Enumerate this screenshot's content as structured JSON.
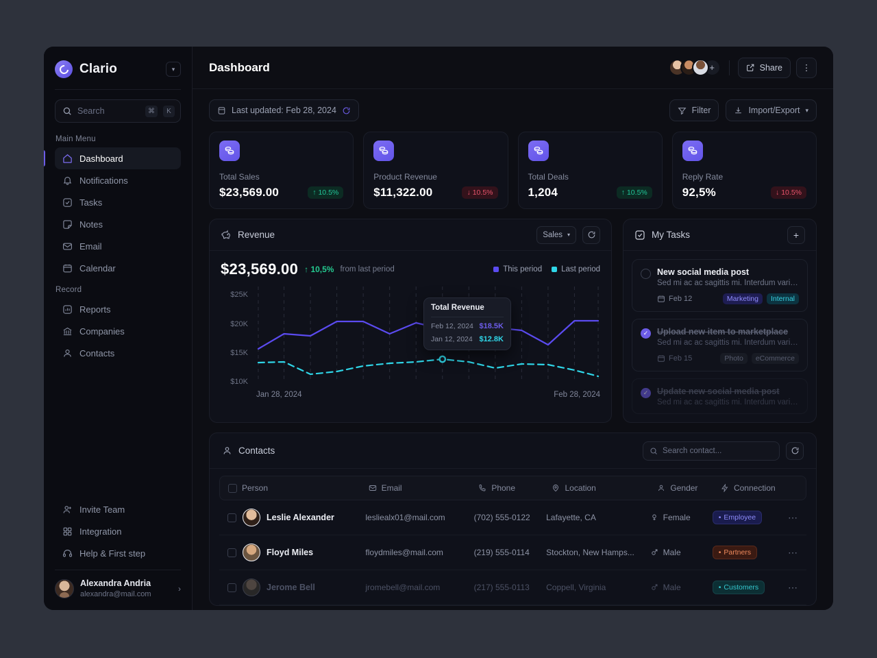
{
  "sidebar": {
    "brand": "Clario",
    "search": {
      "placeholder": "Search",
      "kbd1": "⌘",
      "kbd2": "K"
    },
    "groups": [
      {
        "label": "Main Menu",
        "items": [
          {
            "label": "Dashboard",
            "icon": "home-icon",
            "active": true
          },
          {
            "label": "Notifications",
            "icon": "bell-icon"
          },
          {
            "label": "Tasks",
            "icon": "check-square-icon"
          },
          {
            "label": "Notes",
            "icon": "note-icon"
          },
          {
            "label": "Email",
            "icon": "mail-icon"
          },
          {
            "label": "Calendar",
            "icon": "calendar-icon"
          }
        ]
      },
      {
        "label": "Record",
        "items": [
          {
            "label": "Reports",
            "icon": "chart-bar-icon"
          },
          {
            "label": "Companies",
            "icon": "bank-icon"
          },
          {
            "label": "Contacts",
            "icon": "user-icon"
          }
        ]
      }
    ],
    "bottom": [
      {
        "label": "Invite Team",
        "icon": "user-plus-icon"
      },
      {
        "label": "Integration",
        "icon": "grid-icon"
      },
      {
        "label": "Help & First step",
        "icon": "headset-icon"
      }
    ],
    "user": {
      "name": "Alexandra Andria",
      "email": "alexandra@mail.com"
    }
  },
  "topbar": {
    "title": "Dashboard",
    "add_label": "+",
    "share_label": "Share",
    "more_label": "⋮"
  },
  "toolbar": {
    "last_updated": "Last updated: Feb 28, 2024",
    "filter_label": "Filter",
    "import_export_label": "Import/Export"
  },
  "kpis": [
    {
      "label": "Total Sales",
      "value": "$23,569.00",
      "delta": "10.5%",
      "dir": "up"
    },
    {
      "label": "Product Revenue",
      "value": "$11,322.00",
      "delta": "10.5%",
      "dir": "down"
    },
    {
      "label": "Total Deals",
      "value": "1,204",
      "delta": "10.5%",
      "dir": "up"
    },
    {
      "label": "Reply Rate",
      "value": "92,5%",
      "delta": "10.5%",
      "dir": "down"
    }
  ],
  "revenue": {
    "title": "Revenue",
    "select_value": "Sales",
    "amount": "$23,569.00",
    "delta": "10,5%",
    "delta_note": "from last period",
    "legend": [
      {
        "label": "This period",
        "color": "#5b4bf0"
      },
      {
        "label": "Last period",
        "color": "#2fd6e8"
      }
    ],
    "tooltip": {
      "title": "Total Revenue",
      "rows": [
        {
          "date": "Feb 12, 2024",
          "value": "$18.5K",
          "color": "#6c5ce7"
        },
        {
          "date": "Jan 12, 2024",
          "value": "$12.8K",
          "color": "#2fd6e8"
        }
      ]
    }
  },
  "chart_data": {
    "type": "line",
    "title": "Revenue",
    "xlabel": "",
    "ylabel": "",
    "x_start_label": "Jan 28, 2024",
    "x_end_label": "Feb 28, 2024",
    "ytick_labels": [
      "$25K",
      "$20K",
      "$15K",
      "$10K"
    ],
    "ytick_values": [
      25000,
      20000,
      15000,
      10000
    ],
    "ylim": [
      8500,
      26500
    ],
    "grid": "vertical-dashed",
    "legend_position": "top-right",
    "series": [
      {
        "name": "This period",
        "color": "#5b4bf0",
        "style": "solid",
        "values": [
          15100,
          17700,
          17400,
          19900,
          19900,
          17700,
          19600,
          18500,
          18400,
          18700,
          18300,
          15900,
          20100,
          20100
        ]
      },
      {
        "name": "Last period",
        "color": "#2fd6e8",
        "style": "dashed",
        "values": [
          12700,
          12800,
          10700,
          11200,
          12100,
          12600,
          12800,
          13200,
          12800,
          11800,
          12500,
          12400,
          11500,
          10400
        ]
      }
    ],
    "markers": [
      {
        "series": "This period",
        "index": 7,
        "label": "Feb 12, 2024",
        "value": "$18.5K"
      },
      {
        "series": "Last period",
        "index": 7,
        "label": "Jan 12, 2024",
        "value": "$12.8K"
      }
    ]
  },
  "tasks": {
    "title": "My Tasks",
    "add_label": "+",
    "items": [
      {
        "title": "New social media post",
        "desc": "Sed mi ac ac sagittis mi. Interdum variu...",
        "date": "Feb 12",
        "done": false,
        "tags": [
          {
            "label": "Marketing",
            "style": "marketing"
          },
          {
            "label": "Internal",
            "style": "internal"
          }
        ]
      },
      {
        "title": "Upload new item to marketplace",
        "desc": "Sed mi ac ac sagittis mi. Interdum variu...",
        "date": "Feb 15",
        "done": true,
        "tags": [
          {
            "label": "Photo",
            "style": "muted"
          },
          {
            "label": "eCommerce",
            "style": "muted"
          }
        ]
      },
      {
        "title": "Update new social media post",
        "desc": "Sed mi ac ac sagittis mi. Interdum variu...",
        "date": "",
        "done": true,
        "tags": []
      }
    ]
  },
  "contacts": {
    "title": "Contacts",
    "search_placeholder": "Search contact...",
    "columns": [
      "Person",
      "Email",
      "Phone",
      "Location",
      "Gender",
      "Connection"
    ],
    "rows": [
      {
        "name": "Leslie Alexander",
        "email": "lesliealx01@mail.com",
        "phone": "(702) 555-0122",
        "location": "Lafayette, CA",
        "gender": "Female",
        "connection": "Employee",
        "conn_style": "employee",
        "avatar": "p1"
      },
      {
        "name": "Floyd Miles",
        "email": "floydmiles@mail.com",
        "phone": "(219) 555-0114",
        "location": "Stockton, New Hamps...",
        "gender": "Male",
        "connection": "Partners",
        "conn_style": "partners",
        "avatar": "p2"
      },
      {
        "name": "Jerome Bell",
        "email": "jromebell@mail.com",
        "phone": "(217) 555-0113",
        "location": "Coppell, Virginia",
        "gender": "Male",
        "connection": "Customers",
        "conn_style": "customers",
        "avatar": "p3"
      }
    ]
  }
}
